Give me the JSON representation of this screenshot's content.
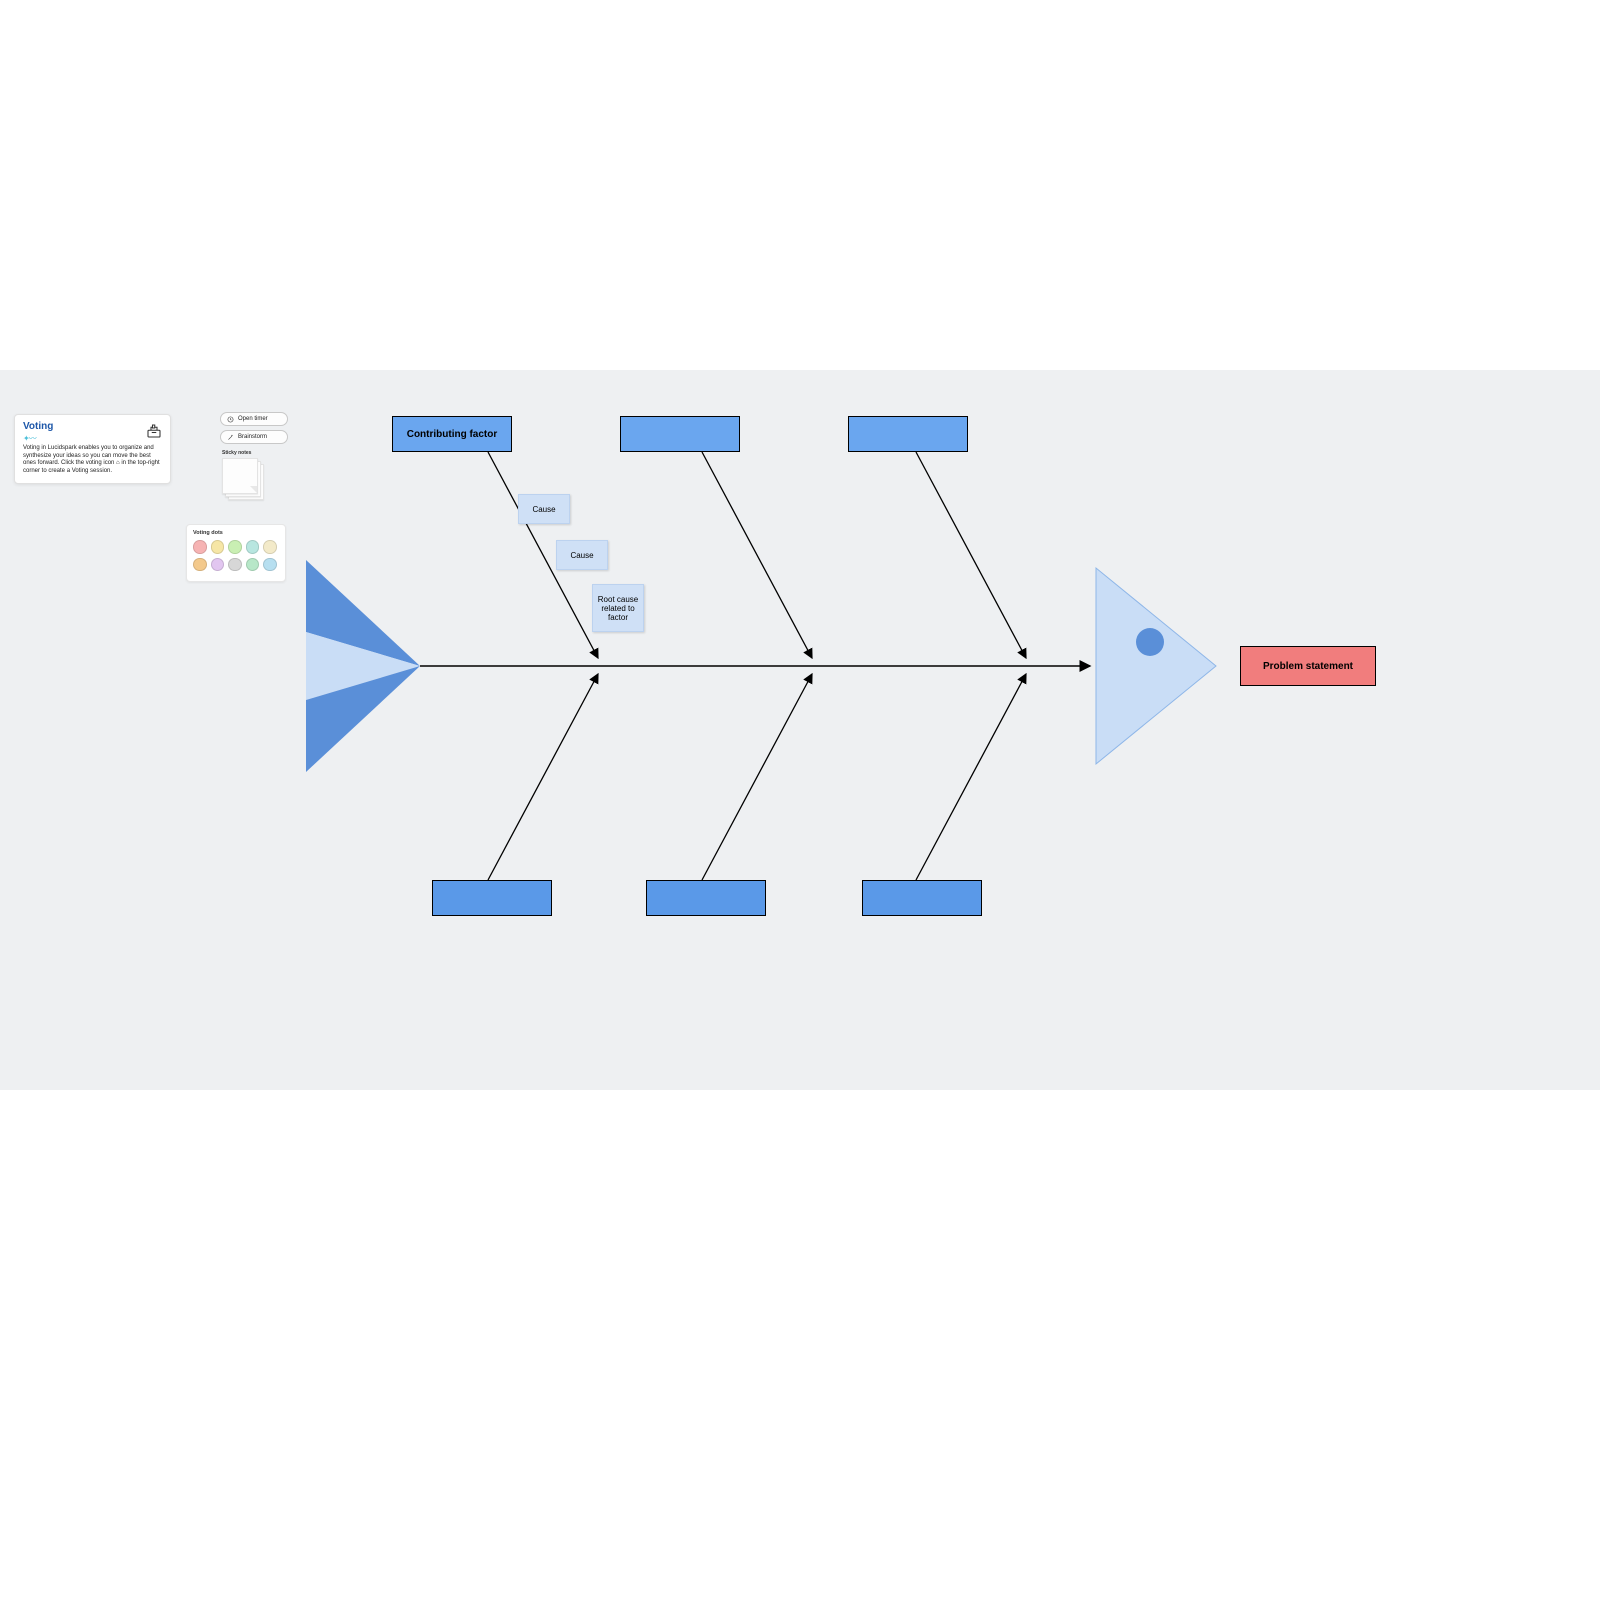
{
  "voting_card": {
    "title": "Voting",
    "body": "Voting in Lucidspark enables you to organize and synthesize your ideas so you can move the best ones forward. Click the voting icon ⌂ in the top-right corner to create a Voting session.",
    "icon_name": "ballot-box-icon"
  },
  "controls": {
    "open_timer": "Open timer",
    "brainstorm": "Brainstorm",
    "sticky_notes_label": "Sticky notes"
  },
  "voting_dots": {
    "label": "Voting dots",
    "colors_row1": [
      "#f6b3b3",
      "#f6e6a6",
      "#c9efb3",
      "#b8e6e0",
      "#f3eac9"
    ],
    "colors_row2": [
      "#f3c98c",
      "#e2c6f0",
      "#d7d7d7",
      "#b7e7c8",
      "#b7dff0"
    ]
  },
  "fishbone": {
    "factor_label": "Contributing factor",
    "cause1": "Cause",
    "cause2": "Cause",
    "root_cause": "Root cause related to factor",
    "problem": "Problem statement"
  },
  "colors": {
    "canvas_bg": "#eef0f2",
    "factor_fill": "#6aa6ef",
    "sticky_fill": "#cfe0f6",
    "head_fill": "#f17d7d",
    "tail_dark": "#5a8fd8",
    "tail_light": "#c9ddf6",
    "head_tri": "#c9ddf6",
    "eye": "#5a8fd8"
  }
}
